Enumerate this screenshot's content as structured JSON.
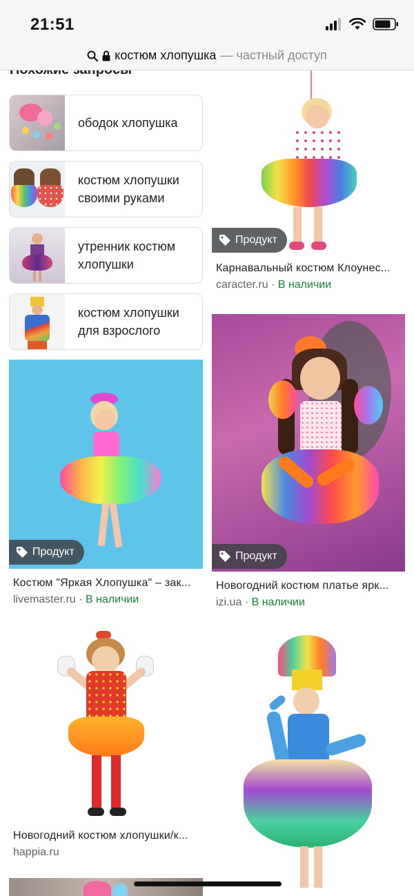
{
  "status_bar": {
    "time": "21:51"
  },
  "url_bar": {
    "query": "костюм хлопушка",
    "suffix": "— частный доступ"
  },
  "related": {
    "title": "Похожие запросы",
    "items": [
      {
        "label": "ободок хлопушка"
      },
      {
        "label": "костюм хлопушки своими руками"
      },
      {
        "label": "утренник костюм хлопушки"
      },
      {
        "label": "костюм хлопушки для взрослого"
      }
    ]
  },
  "results": {
    "product_label": "Продукт",
    "items": [
      {
        "title": "Карнавальный костюм Клоунес...",
        "source": "caracter.ru",
        "separator": "·",
        "stock": "В наличии"
      },
      {
        "title": "Костюм \"Яркая Хлопушка\" – зак...",
        "source": "livemaster.ru",
        "separator": "·",
        "stock": "В наличии"
      },
      {
        "title": "Новогодний костюм платье ярк...",
        "source": "izi.ua",
        "separator": "·",
        "stock": "В наличии"
      },
      {
        "title": "Новогодний костюм хлопушки/к...",
        "source": "happia.ru"
      }
    ]
  },
  "icons": {
    "search": "search-icon",
    "lock": "lock-icon",
    "signal": "signal-icon",
    "wifi": "wifi-icon",
    "battery": "battery-icon",
    "tag": "tag-icon"
  },
  "colors": {
    "stock_green": "#188038",
    "chip_bg": "#3c4043",
    "card_border": "#dadce0"
  }
}
